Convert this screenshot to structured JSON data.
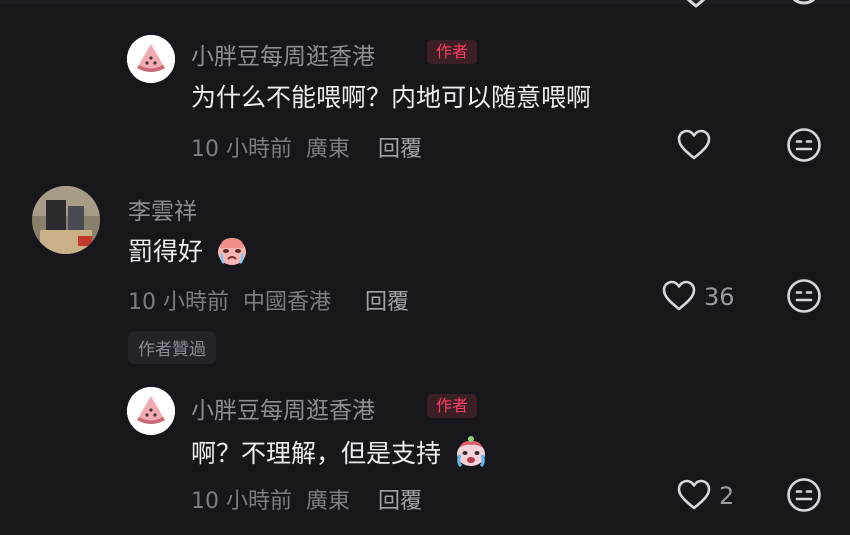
{
  "top_cut": {
    "text": "…"
  },
  "comments": [
    {
      "id": "reply-1",
      "username": "小胖豆每周逛香港",
      "badge": "作者",
      "text": "为什么不能喂啊？内地可以随意喂啊",
      "time": "10 小時前",
      "location": "廣東",
      "reply_label": "回覆",
      "likes": ""
    },
    {
      "id": "comment-2",
      "username": "李雲祥",
      "badge": "",
      "text": "罰得好",
      "time": "10 小時前",
      "location": "中國香港",
      "reply_label": "回覆",
      "likes": "36",
      "author_tag": "作者贊過"
    },
    {
      "id": "reply-2",
      "username": "小胖豆每周逛香港",
      "badge": "作者",
      "text": "啊？不理解，但是支持",
      "time": "10 小時前",
      "location": "廣東",
      "reply_label": "回覆",
      "likes": "2"
    }
  ],
  "icons": {
    "like": "heart-outline-icon",
    "dislike": "neutral-face-icon",
    "emoji_1": "crying-face-emoji",
    "emoji_2": "crying-face-emoji"
  },
  "colors": {
    "background": "#17161b",
    "author_badge_text": "#ff3d5c",
    "author_badge_bg": "#3a1f26"
  }
}
